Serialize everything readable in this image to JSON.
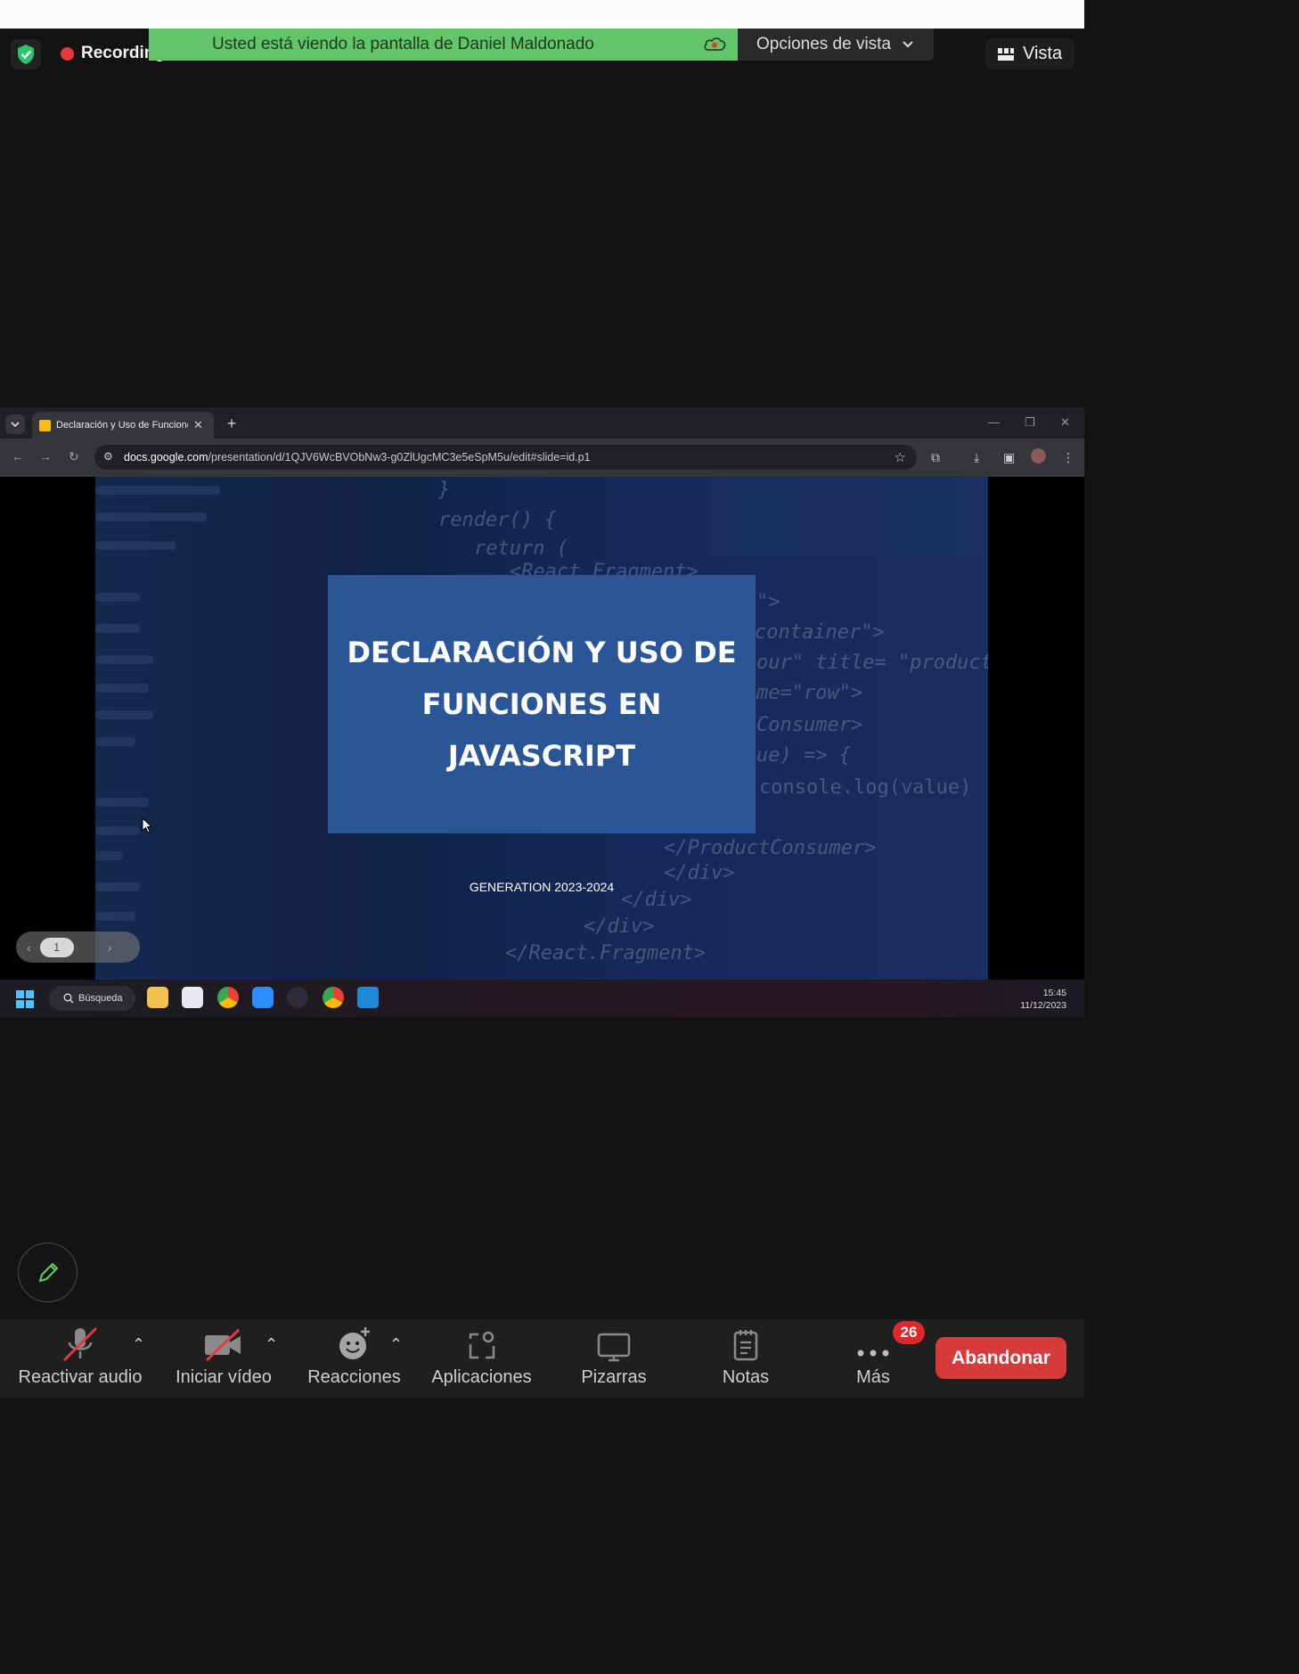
{
  "zoom": {
    "recording_label": "Recording",
    "banner_text": "Usted está viendo la pantalla de Daniel Maldonado",
    "view_options_label": "Opciones de vista",
    "vista_label": "Vista",
    "colors": {
      "banner": "#63c46b",
      "leave": "#d63a3a",
      "badge": "#e02828"
    }
  },
  "browser": {
    "tab_title": "Declaración y Uso de Funciones",
    "url_host": "docs.google.com",
    "url_path": "/presentation/d/1QJV6WcBVObNw3-g0ZlUgcMC3e5eSpM5u/edit#slide=id.p1"
  },
  "slide": {
    "title": "DECLARACIÓN Y USO DE FUNCIONES EN JAVASCRIPT",
    "subtitle": "GENERATION 2023-2024",
    "code_lines": [
      "}",
      "render() {",
      "return (",
      "<React.Fragment>",
      "\">",
      "container\">",
      "our\" title= \"product",
      "me=\"row\">",
      "Consumer>",
      "ue) => {",
      "console.log(value)",
      "</ProductConsumer>",
      "</div>",
      "</div>",
      "</div>",
      "</React.Fragment>"
    ],
    "page_number": "1"
  },
  "taskbar": {
    "search_label": "Búsqueda",
    "time": "15:45",
    "date": "11/12/2023"
  },
  "toolbar": {
    "audio_label": "Reactivar audio",
    "video_label": "Iniciar vídeo",
    "reactions_label": "Reacciones",
    "apps_label": "Aplicaciones",
    "whiteboards_label": "Pizarras",
    "notes_label": "Notas",
    "more_label": "Más",
    "more_badge": "26",
    "leave_label": "Abandonar"
  }
}
